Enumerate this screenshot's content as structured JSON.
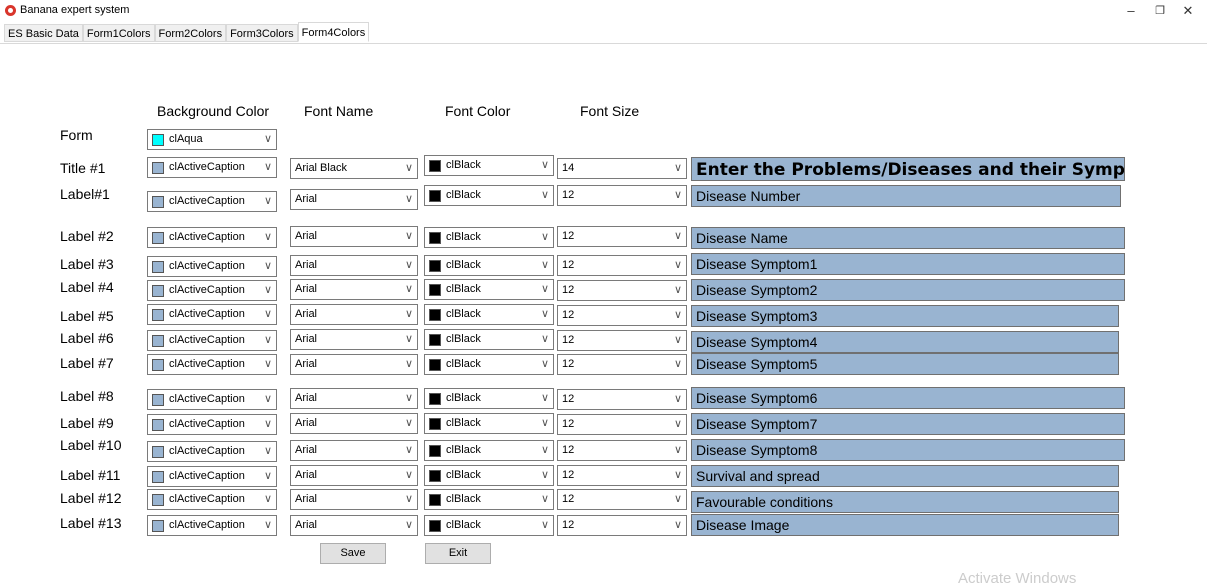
{
  "window": {
    "title": "Banana expert system",
    "minimize_icon": "minimize-icon",
    "restore_icon": "restore-icon",
    "close_icon": "close-icon"
  },
  "tabs": [
    {
      "label": "ES Basic Data",
      "active": false
    },
    {
      "label": "Form1Colors",
      "active": false
    },
    {
      "label": "Form2Colors",
      "active": false
    },
    {
      "label": "Form3Colors",
      "active": false
    },
    {
      "label": "Form4Colors",
      "active": true
    }
  ],
  "headers": {
    "background_color": "Background Color",
    "font_name": "Font Name",
    "font_color": "Font Color",
    "font_size": "Font Size"
  },
  "colors": {
    "clAqua": "#00ffff",
    "clActiveCaption": "#99b4d1",
    "clBlack": "#000000"
  },
  "form_row": {
    "label": "Form",
    "bg_color": "clAqua"
  },
  "rows": [
    {
      "label": "Title #1",
      "bg_color": "clActiveCaption",
      "font_name": "Arial Black",
      "font_color": "clBlack",
      "font_size": "14",
      "preview": "Enter the Problems/Diseases and their Symptoms"
    },
    {
      "label": "Label#1",
      "bg_color": "clActiveCaption",
      "font_name": "Arial",
      "font_color": "clBlack",
      "font_size": "12",
      "preview": "Disease Number"
    },
    {
      "label": "Label #2",
      "bg_color": "clActiveCaption",
      "font_name": "Arial",
      "font_color": "clBlack",
      "font_size": "12",
      "preview": "Disease Name"
    },
    {
      "label": "Label #3",
      "bg_color": "clActiveCaption",
      "font_name": "Arial",
      "font_color": "clBlack",
      "font_size": "12",
      "preview": "Disease Symptom1"
    },
    {
      "label": "Label #4",
      "bg_color": "clActiveCaption",
      "font_name": "Arial",
      "font_color": "clBlack",
      "font_size": "12",
      "preview": "Disease Symptom2"
    },
    {
      "label": "Label #5",
      "bg_color": "clActiveCaption",
      "font_name": "Arial",
      "font_color": "clBlack",
      "font_size": "12",
      "preview": "Disease Symptom3"
    },
    {
      "label": "Label #6",
      "bg_color": "clActiveCaption",
      "font_name": "Arial",
      "font_color": "clBlack",
      "font_size": "12",
      "preview": "Disease Symptom4"
    },
    {
      "label": "Label #7",
      "bg_color": "clActiveCaption",
      "font_name": "Arial",
      "font_color": "clBlack",
      "font_size": "12",
      "preview": "Disease Symptom5"
    },
    {
      "label": "Label #8",
      "bg_color": "clActiveCaption",
      "font_name": "Arial",
      "font_color": "clBlack",
      "font_size": "12",
      "preview": "Disease Symptom6"
    },
    {
      "label": "Label #9",
      "bg_color": "clActiveCaption",
      "font_name": "Arial",
      "font_color": "clBlack",
      "font_size": "12",
      "preview": "Disease Symptom7"
    },
    {
      "label": "Label #10",
      "bg_color": "clActiveCaption",
      "font_name": "Arial",
      "font_color": "clBlack",
      "font_size": "12",
      "preview": "Disease Symptom8"
    },
    {
      "label": "Label #11",
      "bg_color": "clActiveCaption",
      "font_name": "Arial",
      "font_color": "clBlack",
      "font_size": "12",
      "preview": "Survival and spread"
    },
    {
      "label": "Label #12",
      "bg_color": "clActiveCaption",
      "font_name": "Arial",
      "font_color": "clBlack",
      "font_size": "12",
      "preview": "Favourable conditions"
    },
    {
      "label": "Label #13",
      "bg_color": "clActiveCaption",
      "font_name": "Arial",
      "font_color": "clBlack",
      "font_size": "12",
      "preview": "Disease Image"
    }
  ],
  "buttons": {
    "save": "Save",
    "exit": "Exit"
  },
  "watermark": "Activate Windows"
}
